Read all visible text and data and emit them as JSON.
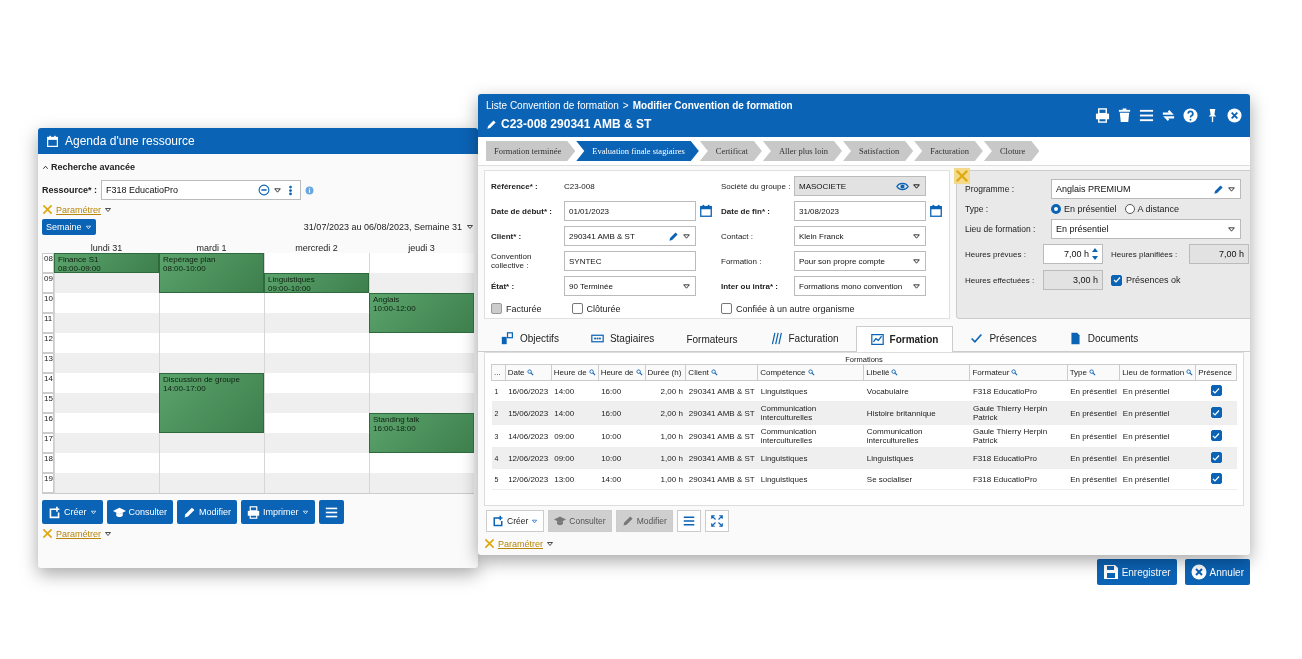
{
  "agenda": {
    "title": "Agenda d'une ressource",
    "search_toggle": "Recherche avancée",
    "resource": {
      "label": "Ressource* :",
      "value": "F318 EducatioPro"
    },
    "settings_link": "Paramétrer",
    "view_button": "Semaine",
    "date_range": "31/07/2023 au 06/08/2023, Semaine 31",
    "hours": [
      "08",
      "09",
      "10",
      "11",
      "12",
      "13",
      "14",
      "15",
      "16",
      "17",
      "18",
      "19"
    ],
    "days": [
      {
        "label": "lundi 31",
        "events": [
          {
            "title": "Finance S1",
            "time": "08:00-09:00"
          }
        ]
      },
      {
        "label": "mardi 1",
        "events": [
          {
            "title": "Repérage plan",
            "time": "08:00-10:00"
          },
          {
            "title": "Discussion de groupe",
            "time": "14:00-17:00"
          }
        ]
      },
      {
        "label": "mercredi 2",
        "events": [
          {
            "title": "Linguistiques",
            "time": "09:00-10:00"
          }
        ]
      },
      {
        "label": "jeudi 3",
        "events": [
          {
            "title": "Anglais",
            "time": "10:00-12:00"
          },
          {
            "title": "Standing talk",
            "time": "16:00-18:00"
          }
        ]
      }
    ],
    "buttons": [
      {
        "kind": "create",
        "label": "Créer",
        "dropdown": true
      },
      {
        "kind": "view",
        "label": "Consulter",
        "dropdown": false
      },
      {
        "kind": "edit",
        "label": "Modifier",
        "dropdown": false
      },
      {
        "kind": "print",
        "label": "Imprimer",
        "dropdown": true
      },
      {
        "kind": "menu",
        "dropdown": false
      }
    ],
    "footer_settings_link": "Paramétrer"
  },
  "convention": {
    "breadcrumb": {
      "parent": "Liste Convention de formation",
      "separator": ">",
      "current": "Modifier Convention de formation"
    },
    "title": "C23-008 290341 AMB & ST",
    "steps": [
      {
        "label": "Formation terminée",
        "selected": false
      },
      {
        "label": "Evaluation finale stagiaires",
        "selected": true
      },
      {
        "label": "Certificat",
        "selected": false
      },
      {
        "label": "Aller plus loin",
        "selected": false
      },
      {
        "label": "Satisfaction",
        "selected": false
      },
      {
        "label": "Facturation",
        "selected": false
      },
      {
        "label": "Cloture",
        "selected": false
      }
    ],
    "form_columns": [
      {
        "fields": [
          {
            "label": "Référence* :",
            "kind": "static",
            "value": "C23-008",
            "required": true
          },
          {
            "label": "Date de début* :",
            "kind": "date",
            "value": "01/01/2023",
            "required": true
          },
          {
            "label": "Client* :",
            "kind": "edit-select",
            "value": "290341 AMB & ST",
            "required": true
          },
          {
            "label": "Convention collective :",
            "kind": "input",
            "value": "SYNTEC",
            "required": false
          },
          {
            "label": "État* :",
            "kind": "select",
            "value": "90 Terminée",
            "required": true
          }
        ],
        "checkboxes": [
          {
            "label": "Facturée",
            "checked": false,
            "disabled": true
          },
          {
            "label": "Clôturée",
            "checked": false,
            "disabled": false
          }
        ]
      },
      {
        "fields": [
          {
            "label": "Société du groupe :",
            "kind": "view-select",
            "value": "MASOCIETE",
            "required": false
          },
          {
            "label": "Date de fin* :",
            "kind": "date",
            "value": "31/08/2023",
            "required": true
          },
          {
            "label": "Contact :",
            "kind": "select",
            "value": "Klein Franck",
            "required": false
          },
          {
            "label": "Formation :",
            "kind": "select",
            "value": "Pour son propre compte",
            "required": false
          },
          {
            "label": "Inter ou intra* :",
            "kind": "select",
            "value": "Formations mono convention",
            "required": true
          }
        ],
        "checkboxes": [
          {
            "label": "Confiée à un autre organisme",
            "checked": false,
            "disabled": false
          }
        ]
      }
    ],
    "panel": {
      "fields": [
        {
          "label": "Programme :",
          "kind": "edit-select",
          "value": "Anglais PREMIUM"
        },
        {
          "label": "Type :",
          "kind": "radio",
          "options": [
            {
              "label": "En présentiel",
              "selected": true
            },
            {
              "label": "A distance",
              "selected": false
            }
          ]
        },
        {
          "label": "Lieu de formation :",
          "kind": "select",
          "value": "En présentiel"
        }
      ],
      "hours": [
        {
          "label": "Heures prévues :",
          "kind": "spin",
          "value": "7,00 h"
        },
        {
          "label": "Heures planifiées :",
          "kind": "readonly",
          "value": "7,00 h"
        },
        {
          "label": "Heures effectuées :",
          "kind": "readonly",
          "value": "3,00 h"
        },
        {
          "label": "Présences ok",
          "kind": "checkbox",
          "checked": true
        }
      ]
    },
    "tabs": [
      {
        "label": "Objectifs",
        "kind": "objectives",
        "selected": false
      },
      {
        "label": "Stagiaires",
        "kind": "trainees",
        "selected": false
      },
      {
        "label": "Formateurs",
        "kind": "plain",
        "selected": false
      },
      {
        "label": "Facturation",
        "kind": "billing",
        "selected": false
      },
      {
        "label": "Formation",
        "kind": "training",
        "selected": true
      },
      {
        "label": "Présences",
        "kind": "attendance",
        "selected": false
      },
      {
        "label": "Documents",
        "kind": "documents",
        "selected": false
      }
    ],
    "table": {
      "caption": "Formations",
      "columns": [
        {
          "label": "...",
          "search": false
        },
        {
          "label": "Date",
          "search": true
        },
        {
          "label": "Heure de",
          "search": true
        },
        {
          "label": "Heure de",
          "search": true
        },
        {
          "label": "Durée (h)",
          "search": false
        },
        {
          "label": "Client",
          "search": true
        },
        {
          "label": "Compétence",
          "search": true
        },
        {
          "label": "Libellé",
          "search": true
        },
        {
          "label": "Formateur",
          "search": true
        },
        {
          "label": "Type",
          "search": true
        },
        {
          "label": "Lieu de formation",
          "search": true
        },
        {
          "label": "Présence",
          "search": false
        }
      ],
      "rows": [
        {
          "cells": [
            "1",
            "16/06/2023",
            "14:00",
            "16:00",
            "2,00 h",
            "290341 AMB & ST",
            "Linguistiques",
            "Vocabulaire",
            "F318 EducatioPro",
            "En présentiel",
            "En présentiel"
          ],
          "presence": true
        },
        {
          "cells": [
            "2",
            "15/06/2023",
            "14:00",
            "16:00",
            "2,00 h",
            "290341 AMB & ST",
            "Communication interculturelles",
            "Histoire britannique",
            "Gaule Thierry Herpin Patrick",
            "En présentiel",
            "En présentiel"
          ],
          "presence": true
        },
        {
          "cells": [
            "3",
            "14/06/2023",
            "09:00",
            "10:00",
            "1,00 h",
            "290341 AMB & ST",
            "Communication interculturelles",
            "Communication interculturelles",
            "Gaule Thierry Herpin Patrick",
            "En présentiel",
            "En présentiel"
          ],
          "presence": true
        },
        {
          "cells": [
            "4",
            "12/06/2023",
            "09:00",
            "10:00",
            "1,00 h",
            "290341 AMB & ST",
            "Linguistiques",
            "Linguistiques",
            "F318 EducatioPro",
            "En présentiel",
            "En présentiel"
          ],
          "presence": true
        },
        {
          "cells": [
            "5",
            "12/06/2023",
            "13:00",
            "14:00",
            "1,00 h",
            "290341 AMB & ST",
            "Linguistiques",
            "Se socialiser",
            "F318 EducatioPro",
            "En présentiel",
            "En présentiel"
          ],
          "presence": true
        }
      ]
    },
    "toolbar": [
      {
        "kind": "create",
        "label": "Créer",
        "dropdown": true,
        "disabled": false
      },
      {
        "kind": "view",
        "label": "Consulter",
        "dropdown": false,
        "disabled": true
      },
      {
        "kind": "edit",
        "label": "Modifier",
        "dropdown": false,
        "disabled": true
      },
      {
        "kind": "menu",
        "dropdown": false,
        "disabled": false
      },
      {
        "kind": "expand",
        "dropdown": false,
        "disabled": false
      }
    ],
    "settings_link": "Paramétrer",
    "actions": [
      {
        "kind": "save",
        "label": "Enregistrer"
      },
      {
        "kind": "cancel",
        "label": "Annuler"
      }
    ]
  }
}
